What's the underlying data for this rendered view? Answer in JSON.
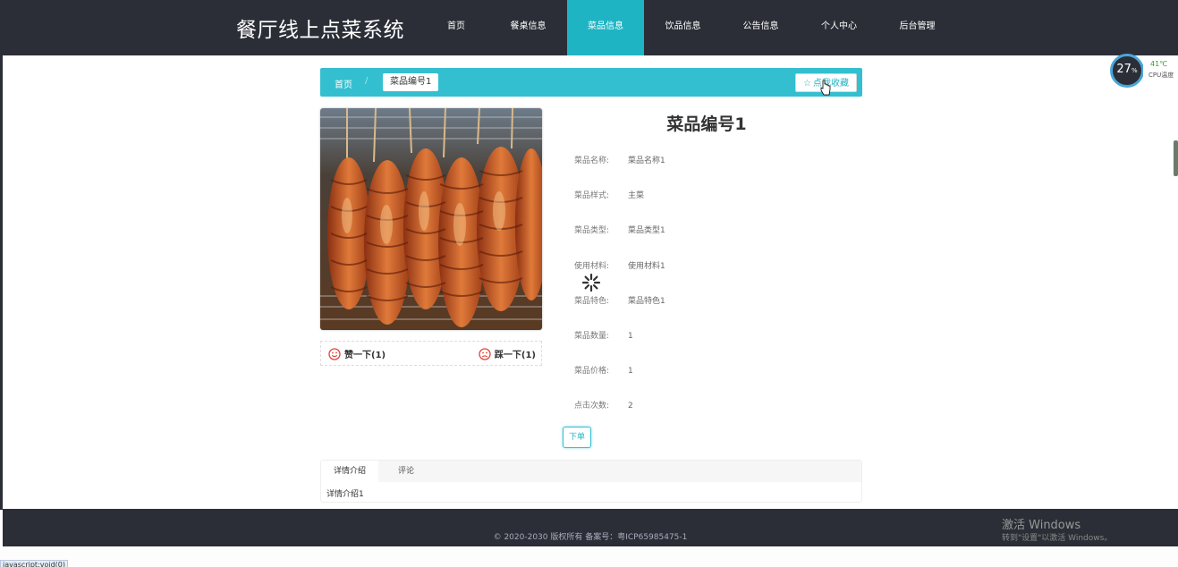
{
  "brand": "餐厅线上点菜系统",
  "menu": [
    {
      "label": "首页",
      "active": false
    },
    {
      "label": "餐桌信息",
      "active": false
    },
    {
      "label": "菜品信息",
      "active": true
    },
    {
      "label": "饮品信息",
      "active": false
    },
    {
      "label": "公告信息",
      "active": false
    },
    {
      "label": "个人中心",
      "active": false
    },
    {
      "label": "后台管理",
      "active": false
    }
  ],
  "breadcrumb": {
    "home": "首页",
    "separator": "/",
    "current": "菜品编号1"
  },
  "favorite_label": "点我收藏",
  "dish": {
    "title": "菜品编号1",
    "fields": [
      {
        "key": "菜品名称:",
        "value": "菜品名称1"
      },
      {
        "key": "菜品样式:",
        "value": "主菜"
      },
      {
        "key": "菜品类型:",
        "value": "菜品类型1"
      },
      {
        "key": "使用材料:",
        "value": "使用材料1"
      },
      {
        "key": "菜品特色:",
        "value": "菜品特色1"
      },
      {
        "key": "菜品数量:",
        "value": "1"
      },
      {
        "key": "菜品价格:",
        "value": "1"
      },
      {
        "key": "点击次数:",
        "value": "2"
      }
    ]
  },
  "like_label": "赞一下(1)",
  "dislike_label": "踩一下(1)",
  "order_label": "下单",
  "tabs": [
    {
      "label": "详情介绍",
      "active": true
    },
    {
      "label": "评论",
      "active": false
    }
  ],
  "tab_content": "详情介绍1",
  "footer": "© 2020-2030 版权所有 备案号：粤ICP65985475-1",
  "watermark": {
    "line1": "激活 Windows",
    "line2": "转到\"设置\"以激活 Windows。"
  },
  "gauge": {
    "percent": "27",
    "unit": "%",
    "temp": "41℃",
    "label": "CPU温度"
  },
  "status_url": "javascript:void(0)",
  "colors": {
    "nav": "#2b2e36",
    "accent": "#1fb4c4",
    "crumb": "#33bfd0"
  }
}
